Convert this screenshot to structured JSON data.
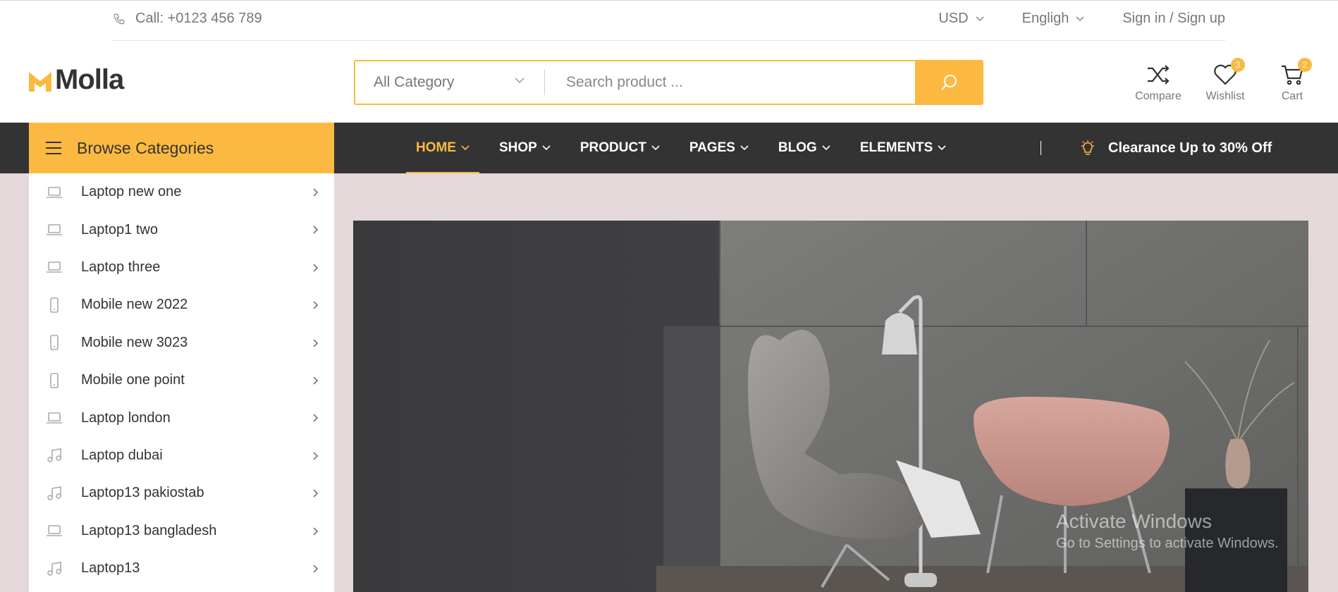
{
  "topbar": {
    "call": "Call: +0123 456 789",
    "currency": "USD",
    "language": "Engligh",
    "sign": "Sign in / Sign up"
  },
  "brand": {
    "name": "Molla",
    "accent": "#fcb941",
    "dark": "#333333"
  },
  "search": {
    "category": "All Category",
    "placeholder": "Search product ..."
  },
  "header_icons": {
    "compare": {
      "label": "Compare"
    },
    "wishlist": {
      "label": "Wishlist",
      "count": "3"
    },
    "cart": {
      "label": "Cart",
      "count": "2"
    }
  },
  "browse": {
    "label": "Browse Categories"
  },
  "nav": {
    "items": [
      {
        "label": "HOME"
      },
      {
        "label": "SHOP"
      },
      {
        "label": "PRODUCT"
      },
      {
        "label": "PAGES"
      },
      {
        "label": "BLOG"
      },
      {
        "label": "ELEMENTS"
      }
    ],
    "promo": "Clearance Up to 30% Off"
  },
  "categories": [
    {
      "label": "Laptop new one",
      "icon": "laptop-icon"
    },
    {
      "label": "Laptop1 two",
      "icon": "laptop-icon"
    },
    {
      "label": "Laptop three",
      "icon": "laptop-icon"
    },
    {
      "label": "Mobile new 2022",
      "icon": "mobile-icon"
    },
    {
      "label": "Mobile new 3023",
      "icon": "mobile-icon"
    },
    {
      "label": "Mobile one point",
      "icon": "mobile-icon"
    },
    {
      "label": "Laptop london",
      "icon": "laptop-icon"
    },
    {
      "label": "Laptop dubai",
      "icon": "music-icon"
    },
    {
      "label": "Laptop13 pakiostab",
      "icon": "music-icon"
    },
    {
      "label": "Laptop13 bangladesh",
      "icon": "laptop-icon"
    },
    {
      "label": "Laptop13",
      "icon": "music-icon"
    }
  ],
  "watermark": {
    "line1": "Activate Windows",
    "line2": "Go to Settings to activate Windows."
  }
}
